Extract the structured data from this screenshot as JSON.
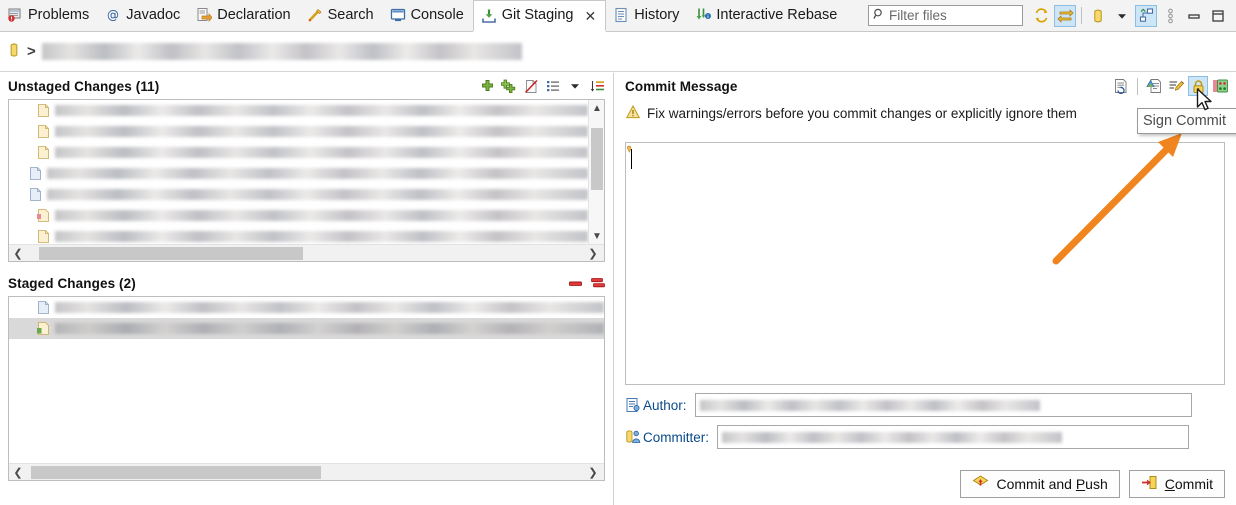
{
  "window": {
    "app": "Eclipse IDE",
    "view": "Git Staging"
  },
  "tabbar": {
    "tabs": [
      {
        "label": "Problems",
        "icon": "problems-icon",
        "active": false,
        "closable": false
      },
      {
        "label": "Javadoc",
        "icon": "javadoc-icon",
        "active": false,
        "closable": false
      },
      {
        "label": "Declaration",
        "icon": "declaration-icon",
        "active": false,
        "closable": false
      },
      {
        "label": "Search",
        "icon": "search-icon",
        "active": false,
        "closable": false
      },
      {
        "label": "Console",
        "icon": "console-icon",
        "active": false,
        "closable": false
      },
      {
        "label": "Git Staging",
        "icon": "git-staging-icon",
        "active": true,
        "closable": true
      },
      {
        "label": "History",
        "icon": "history-icon",
        "active": false,
        "closable": false
      },
      {
        "label": "Interactive Rebase",
        "icon": "interactive-rebase-icon",
        "active": false,
        "closable": false
      }
    ],
    "close_glyph": "✕",
    "filter": {
      "placeholder": "Filter files",
      "value": "",
      "icon": "search-magnifier-icon"
    },
    "tools": [
      {
        "name": "refresh-icon",
        "selected": false
      },
      {
        "name": "link-selection-icon",
        "selected": true
      },
      {
        "name": "repository-icon",
        "selected": false
      },
      {
        "name": "repository-dropdown-arrow-icon",
        "selected": false
      },
      {
        "name": "presentation-layout-icon",
        "selected": true
      },
      {
        "name": "view-menu-icon",
        "selected": false
      },
      {
        "name": "minimize-view-icon",
        "selected": false
      },
      {
        "name": "maximize-view-icon",
        "selected": false
      }
    ]
  },
  "breadcrumb": {
    "repo_icon": "repository-icon",
    "separator": ">",
    "path": "░░░░░░░░ ░░░░░░ ░░░ ░░░░░░░░░░░░░░░░░░░░░░░░░░░░░░░░░░░░░░░░░░"
  },
  "unstaged": {
    "title": "Unstaged Changes (11)",
    "count": 11,
    "tools": [
      {
        "name": "add-to-index-icon"
      },
      {
        "name": "add-all-to-index-icon"
      },
      {
        "name": "ignore-file-icon"
      },
      {
        "name": "list-presentation-icon"
      },
      {
        "name": "presentation-dropdown-arrow-icon"
      },
      {
        "name": "sort-icon"
      }
    ],
    "rows": [
      {
        "status": "modified",
        "width_pct": 96,
        "selected": false
      },
      {
        "status": "modified",
        "width_pct": 55,
        "selected": false
      },
      {
        "status": "modified",
        "width_pct": 95,
        "selected": false
      },
      {
        "status": "modified",
        "width_pct": 97,
        "selected": false
      },
      {
        "status": "modified",
        "width_pct": 94,
        "selected": false
      },
      {
        "status": "conflict",
        "width_pct": 96,
        "selected": false
      },
      {
        "status": "modified",
        "width_pct": 64,
        "selected": false
      }
    ],
    "vscroll": {
      "thumb_top_pct": 20,
      "thumb_height_pct": 42
    },
    "hscroll": {
      "thumb_left_pct": 3,
      "thumb_width_pct": 46
    }
  },
  "staged": {
    "title": "Staged Changes (2)",
    "count": 2,
    "tools": [
      {
        "name": "remove-from-index-icon"
      },
      {
        "name": "remove-all-from-index-icon"
      }
    ],
    "rows": [
      {
        "status": "staged-modified",
        "width_pct": 99,
        "selected": false
      },
      {
        "status": "staged-added",
        "width_pct": 99,
        "selected": true
      }
    ],
    "hscroll": {
      "thumb_left_pct": 2,
      "thumb_width_pct": 47
    }
  },
  "commit": {
    "title": "Commit Message",
    "tools": [
      {
        "name": "amend-previous-commit-icon",
        "selected": false
      },
      {
        "name": "add-signed-off-by-icon",
        "selected": false
      },
      {
        "name": "add-change-id-icon",
        "selected": false
      },
      {
        "name": "sign-commit-icon",
        "selected": true
      },
      {
        "name": "commit-message-preview-icon",
        "selected": false
      }
    ],
    "warning": {
      "icon": "warning-icon",
      "text": "Fix warnings/errors before you commit changes or explicitly ignore them"
    },
    "message": {
      "value": "",
      "quote_icon": "quote-marker-icon"
    },
    "author": {
      "icon": "author-icon",
      "label": "Author:",
      "value": "░░░░░░░░░░░ ░░░░░░░░░░░░░░░░░░░░░░"
    },
    "committer": {
      "icon": "committer-icon",
      "label": "Committer:",
      "value": "░░░░░░░░░░░ ░░░░░░░░░░░░░░░░░░░░░░"
    },
    "buttons": [
      {
        "name": "commit-and-push-button",
        "pre": "Commit and ",
        "mnemonic": "P",
        "post": "ush",
        "icon": "push-icon"
      },
      {
        "name": "commit-button",
        "pre": "",
        "mnemonic": "C",
        "post": "ommit",
        "icon": "commit-icon"
      }
    ]
  },
  "tooltip": {
    "text": "Sign Commit",
    "target": "sign-commit-icon"
  },
  "annotation": {
    "arrow_color": "#f0851f",
    "points_to": "sign-commit-icon"
  },
  "colors": {
    "accent_blue": "#cde6f7",
    "selection_gray": "#d9d9d9",
    "link_blue": "#0a4a8a",
    "arrow_orange": "#f0851f",
    "warning_amber": "#d9a300"
  }
}
